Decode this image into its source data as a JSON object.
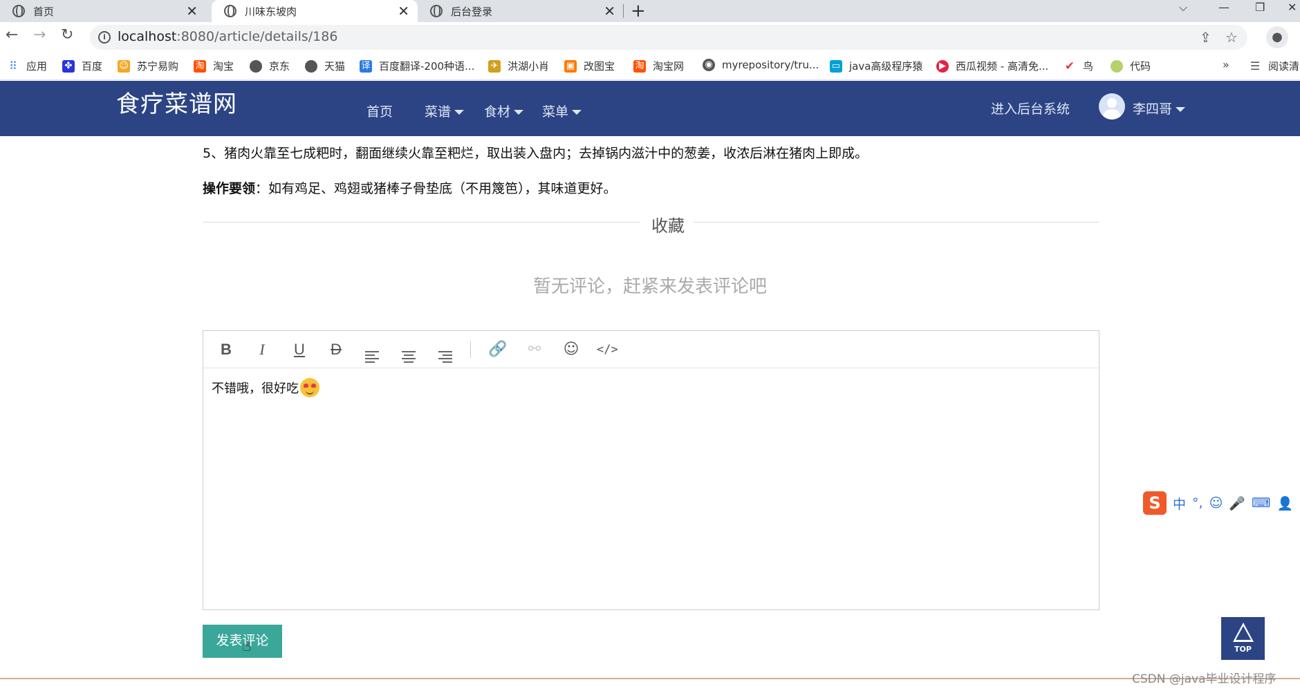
{
  "browser": {
    "tabs": [
      {
        "title": "首页"
      },
      {
        "title": "川味东坡肉"
      },
      {
        "title": "后台登录"
      }
    ],
    "new_tab": "+",
    "url_host": "localhost",
    "url_rest": ":8080/article/details/186",
    "bookmarks": [
      {
        "label": "应用",
        "color": "#4285f4"
      },
      {
        "label": "百度",
        "color": "#2932e1"
      },
      {
        "label": "苏宁易购",
        "color": "#f5a623"
      },
      {
        "label": "淘宝",
        "color": "#ff5000"
      },
      {
        "label": "京东",
        "color": "#555555"
      },
      {
        "label": "天猫",
        "color": "#555555"
      },
      {
        "label": "百度翻译-200种语...",
        "color": "#2a7be4"
      },
      {
        "label": "洪湖小肖",
        "color": "#d0a020"
      },
      {
        "label": "改图宝",
        "color": "#ff7a00"
      },
      {
        "label": "淘宝网",
        "color": "#ff5000"
      },
      {
        "label": "myrepository/tru...",
        "color": "#555555"
      },
      {
        "label": "java高级程序猿",
        "color": "#00a1d6"
      },
      {
        "label": "西瓜视频 - 高清免...",
        "color": "#e62244"
      },
      {
        "label": "鸟",
        "color": "#e4393c"
      },
      {
        "label": "代码",
        "color": "#b5d16a"
      }
    ],
    "reading_list": "阅读清"
  },
  "site": {
    "brand": "食疗菜谱网",
    "nav": [
      "首页",
      "菜谱",
      "食材",
      "菜单"
    ],
    "backend_link": "进入后台系统",
    "username": "李四哥"
  },
  "article": {
    "step5": "5、猪肉火靠至七成粑时，翻面继续火靠至粑烂，取出装入盘内；去掉锅内滋汁中的葱姜，收浓后淋在猪肉上即成。",
    "tip_label": "操作要领",
    "tip_text": "：如有鸡足、鸡翅或猪棒子骨垫底（不用篾笆），其味道更好。",
    "favorite": "收藏",
    "no_comments": "暂无评论，赶紧来发表评论吧"
  },
  "editor": {
    "content": "不错哦，很好吃",
    "toolbar": [
      "bold-icon",
      "italic-icon",
      "underline-icon",
      "strikethrough-icon",
      "align-left-icon",
      "align-center-icon",
      "align-right-icon",
      "link-icon",
      "unlink-icon",
      "emoji-icon",
      "code-icon"
    ]
  },
  "submit_label": "发表评论",
  "totop_label": "TOP",
  "ime": [
    "中",
    "°,"
  ],
  "watermark": "CSDN @java毕业设计程序"
}
